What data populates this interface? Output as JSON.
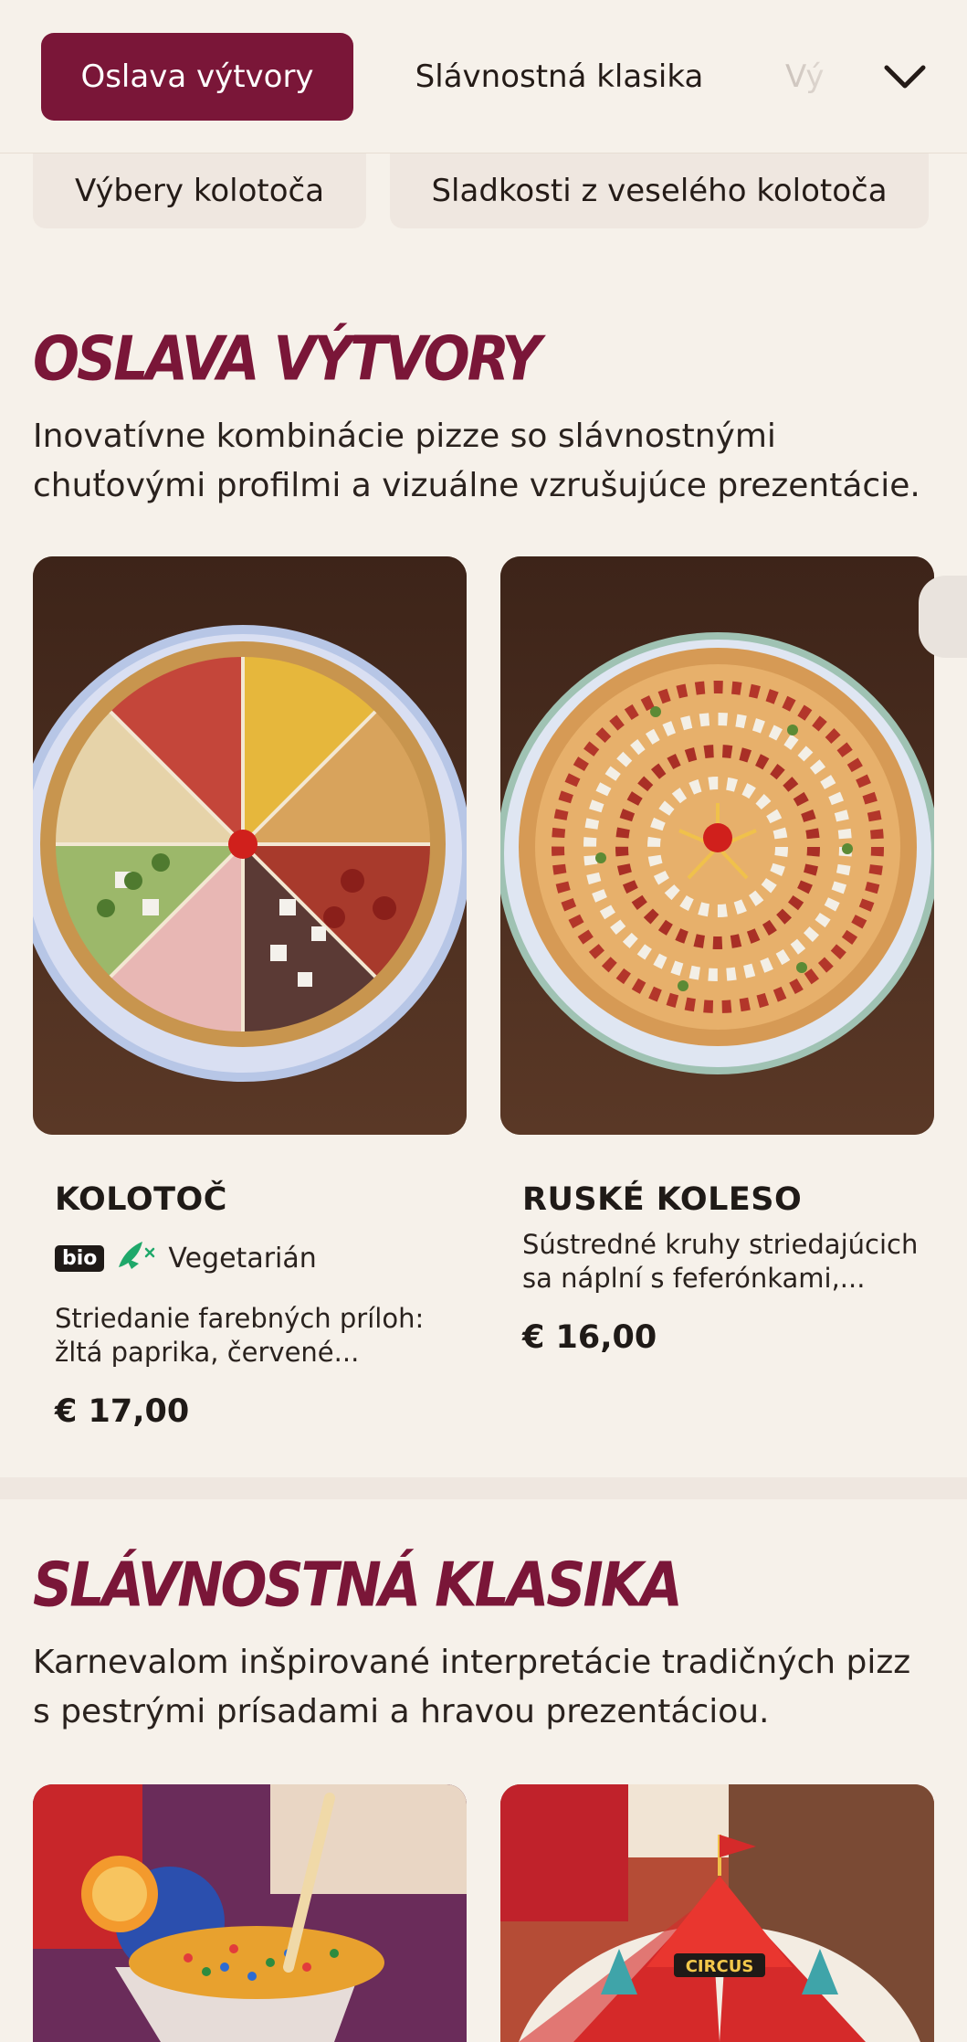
{
  "nav": {
    "tabs": [
      {
        "label": "Oslava výtvory"
      },
      {
        "label": "Slávnostná klasika"
      },
      {
        "label": "Vý"
      }
    ],
    "second_row": [
      {
        "label": "Výbery kolotoča"
      },
      {
        "label": "Sladkosti z veselého kolotoča"
      }
    ],
    "expand_icon": "chevron-down-icon"
  },
  "sections": [
    {
      "title": "Oslava výtvory",
      "description": "Inovatívne kombinácie pizze so slávnostnými chuťovými profilmi a vizuálne vzrušujúce prezentácie.",
      "items": [
        {
          "name": "KOLOTOČ",
          "badge": "bio",
          "tag": "Vegetarián",
          "description_line1": "Striedanie farebných príloh:",
          "description_line2": "žltá paprika, červené...",
          "price": "€ 17,00"
        },
        {
          "name": "RUSKÉ KOLESO",
          "description_line1": "Sústredné kruhy striedajúcich",
          "description_line2": "sa náplní s feferónkami,...",
          "price": "€ 16,00"
        }
      ]
    },
    {
      "title": "Slávnostná klasika",
      "description": "Karnevalom inšpirované interpretácie tradičných pizz s pestrými prísadami a hravou prezentáciou.",
      "items": [
        {
          "image_label": "CIRCUS"
        }
      ]
    }
  ],
  "colors": {
    "accent": "#7a1638",
    "background": "#f6f1ea",
    "tab_inactive_bg": "#efe7e0",
    "veg_icon": "#1fa86a"
  }
}
